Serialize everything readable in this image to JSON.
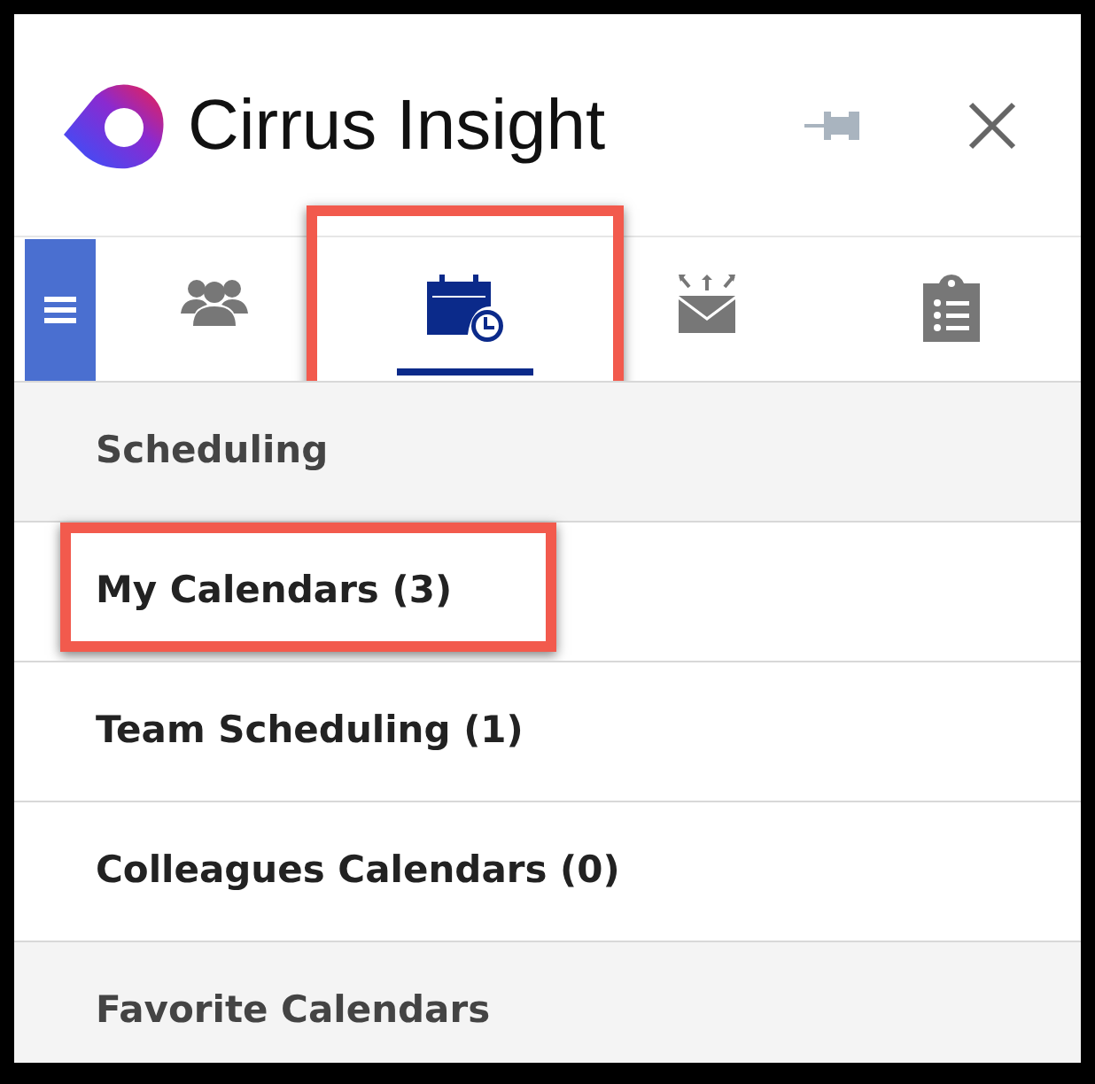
{
  "header": {
    "brand": "Cirrus Insight",
    "pinned": false
  },
  "tabs": [
    {
      "kind": "people",
      "selected": false,
      "highlighted": false
    },
    {
      "kind": "calendar",
      "selected": true,
      "highlighted": true
    },
    {
      "kind": "mail",
      "selected": false,
      "highlighted": false
    },
    {
      "kind": "clipboard",
      "selected": false,
      "highlighted": false
    }
  ],
  "sections": [
    {
      "kind": "header",
      "label": "Scheduling",
      "highlighted": false
    },
    {
      "kind": "item",
      "label": "My Calendars (3)",
      "highlighted": true
    },
    {
      "kind": "item",
      "label": "Team Scheduling (1)",
      "highlighted": false
    },
    {
      "kind": "item",
      "label": "Colleagues Calendars (0)",
      "highlighted": false
    },
    {
      "kind": "header",
      "label": "Favorite Calendars",
      "highlighted": false
    }
  ]
}
